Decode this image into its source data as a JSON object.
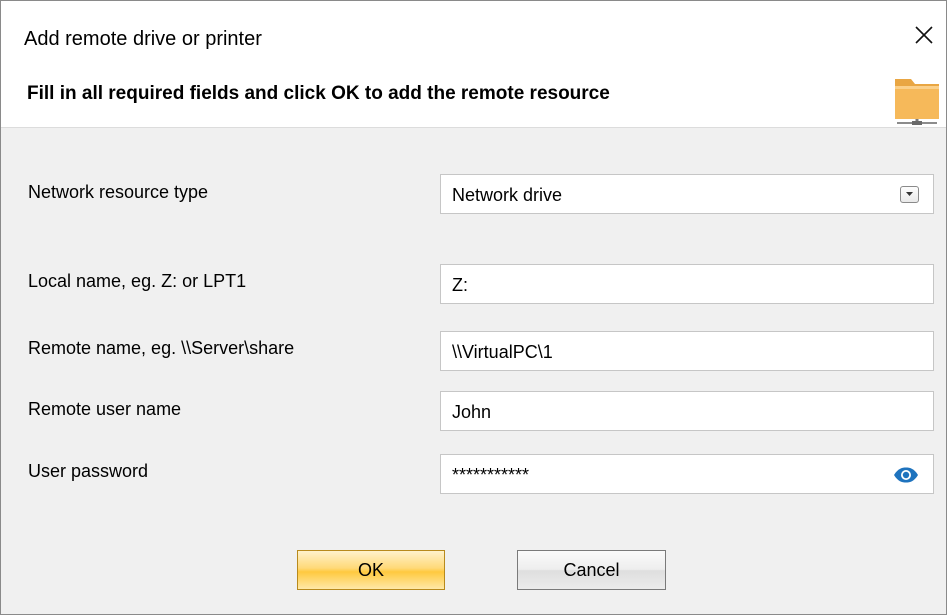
{
  "window": {
    "title": "Add remote drive or printer",
    "close_icon": "close-icon"
  },
  "header": {
    "instruction": "Fill in all required fields and click OK to add the remote resource",
    "icon": "network-folder-icon"
  },
  "form": {
    "resource_type": {
      "label": "Network resource type",
      "value": "Network drive",
      "icon": "chevron-down-icon"
    },
    "local_name": {
      "label": "Local name, eg. Z: or LPT1",
      "value": "Z:"
    },
    "remote_name": {
      "label": "Remote name, eg. \\\\Server\\share",
      "value": "\\\\VirtualPC\\1"
    },
    "remote_user": {
      "label": "Remote user name",
      "value": "John"
    },
    "password": {
      "label": "User password",
      "value": "***********",
      "icon": "eye-icon"
    }
  },
  "buttons": {
    "ok_label": "OK",
    "cancel_label": "Cancel"
  },
  "colors": {
    "ok_button": "#ffd978",
    "eye_icon": "#1e73be",
    "folder_icon": "#f6b95a"
  }
}
